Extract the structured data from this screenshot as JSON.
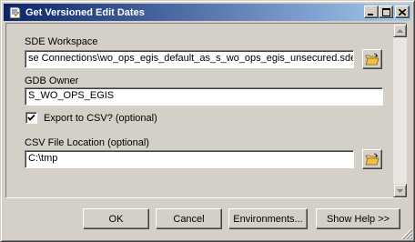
{
  "window": {
    "title": "Get Versioned Edit Dates",
    "icon": "script-tool-icon"
  },
  "title_buttons": [
    "minimize-icon",
    "maximize-icon",
    "close-icon"
  ],
  "form": {
    "sde_workspace": {
      "label": "SDE Workspace",
      "value": "se Connections\\wo_ops_egis_default_as_s_wo_ops_egis_unsecured.sde"
    },
    "gdb_owner": {
      "label": "GDB Owner",
      "value": "S_WO_OPS_EGIS"
    },
    "export_csv": {
      "label": "Export to CSV? (optional)",
      "checked": true
    },
    "csv_location": {
      "label": "CSV File Location (optional)",
      "value": "C:\\tmp"
    }
  },
  "buttons": {
    "ok": "OK",
    "cancel": "Cancel",
    "environments": "Environments...",
    "show_help": "Show Help >>"
  },
  "colors": {
    "title_start": "#0a246a",
    "title_end": "#a6caf0",
    "face": "#d4d0c8"
  }
}
